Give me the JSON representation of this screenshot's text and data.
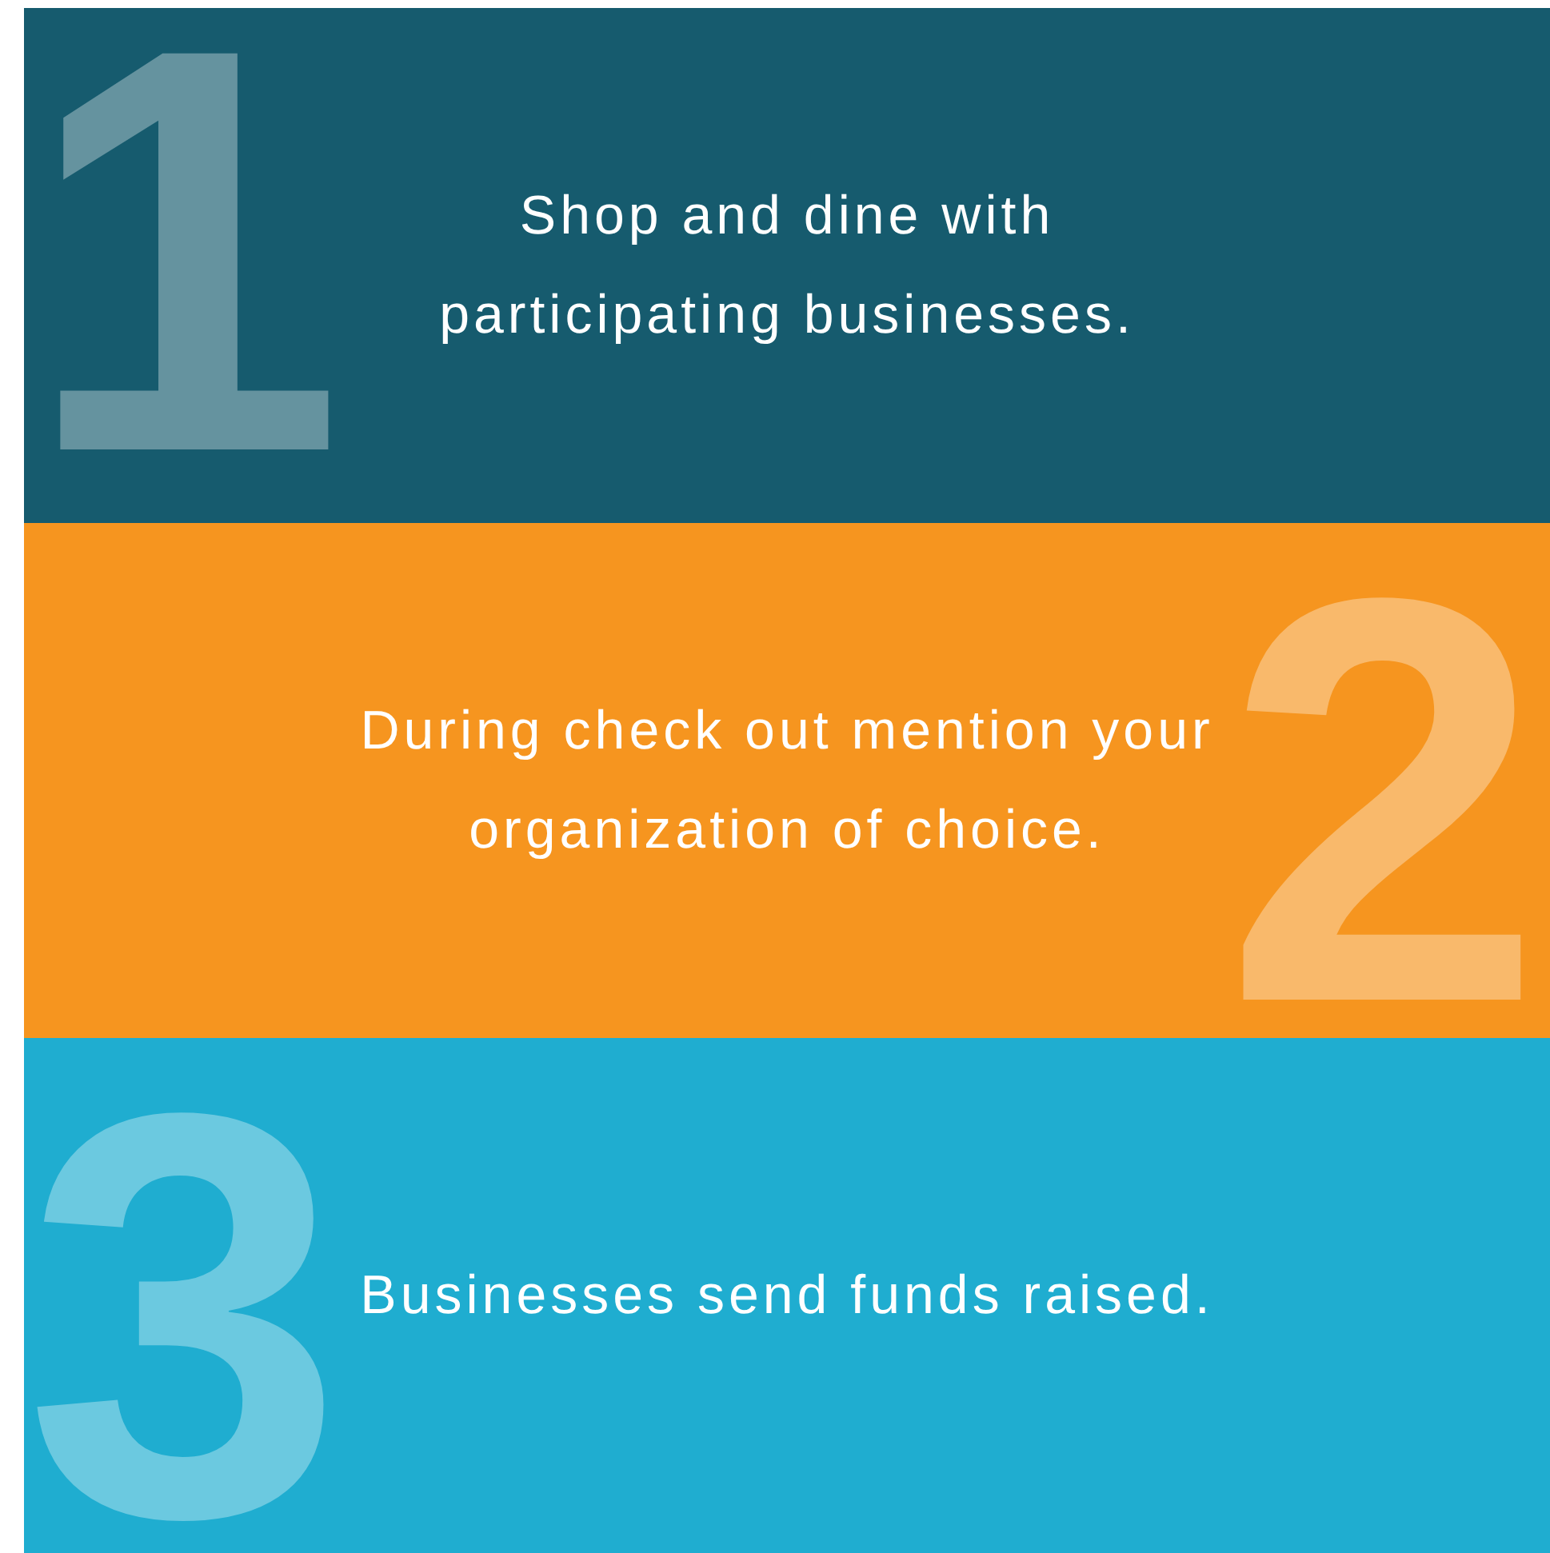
{
  "steps": [
    {
      "number": "1",
      "text": "Shop and dine with participating businesses.",
      "color": "#165b6e"
    },
    {
      "number": "2",
      "text": "During check out mention your organization of choice.",
      "color": "#f6951f"
    },
    {
      "number": "3",
      "text": "Businesses send funds raised.",
      "color": "#1fadd0"
    }
  ]
}
